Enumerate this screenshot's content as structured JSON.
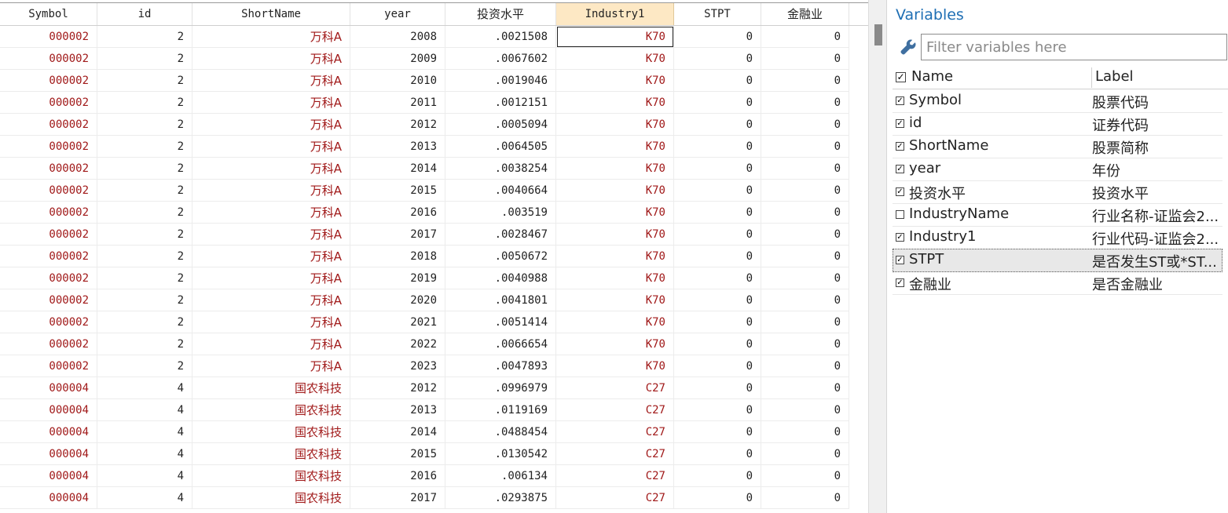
{
  "grid": {
    "columns": [
      "Symbol",
      "id",
      "ShortName",
      "year",
      "投资水平",
      "Industry1",
      "STPT",
      "金融业"
    ],
    "selected_column": "Industry1",
    "rows": [
      [
        "000002",
        "2",
        "万科A",
        "2008",
        ".0021508",
        "K70",
        "0",
        "0"
      ],
      [
        "000002",
        "2",
        "万科A",
        "2009",
        ".0067602",
        "K70",
        "0",
        "0"
      ],
      [
        "000002",
        "2",
        "万科A",
        "2010",
        ".0019046",
        "K70",
        "0",
        "0"
      ],
      [
        "000002",
        "2",
        "万科A",
        "2011",
        ".0012151",
        "K70",
        "0",
        "0"
      ],
      [
        "000002",
        "2",
        "万科A",
        "2012",
        ".0005094",
        "K70",
        "0",
        "0"
      ],
      [
        "000002",
        "2",
        "万科A",
        "2013",
        ".0064505",
        "K70",
        "0",
        "0"
      ],
      [
        "000002",
        "2",
        "万科A",
        "2014",
        ".0038254",
        "K70",
        "0",
        "0"
      ],
      [
        "000002",
        "2",
        "万科A",
        "2015",
        ".0040664",
        "K70",
        "0",
        "0"
      ],
      [
        "000002",
        "2",
        "万科A",
        "2016",
        ".003519",
        "K70",
        "0",
        "0"
      ],
      [
        "000002",
        "2",
        "万科A",
        "2017",
        ".0028467",
        "K70",
        "0",
        "0"
      ],
      [
        "000002",
        "2",
        "万科A",
        "2018",
        ".0050672",
        "K70",
        "0",
        "0"
      ],
      [
        "000002",
        "2",
        "万科A",
        "2019",
        ".0040988",
        "K70",
        "0",
        "0"
      ],
      [
        "000002",
        "2",
        "万科A",
        "2020",
        ".0041801",
        "K70",
        "0",
        "0"
      ],
      [
        "000002",
        "2",
        "万科A",
        "2021",
        ".0051414",
        "K70",
        "0",
        "0"
      ],
      [
        "000002",
        "2",
        "万科A",
        "2022",
        ".0066654",
        "K70",
        "0",
        "0"
      ],
      [
        "000002",
        "2",
        "万科A",
        "2023",
        ".0047893",
        "K70",
        "0",
        "0"
      ],
      [
        "000004",
        "4",
        "国农科技",
        "2012",
        ".0996979",
        "C27",
        "0",
        "0"
      ],
      [
        "000004",
        "4",
        "国农科技",
        "2013",
        ".0119169",
        "C27",
        "0",
        "0"
      ],
      [
        "000004",
        "4",
        "国农科技",
        "2014",
        ".0488454",
        "C27",
        "0",
        "0"
      ],
      [
        "000004",
        "4",
        "国农科技",
        "2015",
        ".0130542",
        "C27",
        "0",
        "0"
      ],
      [
        "000004",
        "4",
        "国农科技",
        "2016",
        ".006134",
        "C27",
        "0",
        "0"
      ],
      [
        "000004",
        "4",
        "国农科技",
        "2017",
        ".0293875",
        "C27",
        "0",
        "0"
      ]
    ],
    "colors": {
      "string_text": "#a01818",
      "numeric_text": "#222222",
      "selected_header_bg": "#fde8c4"
    }
  },
  "variables_panel": {
    "title": "Variables",
    "filter_placeholder": "Filter variables here",
    "filter_icon": "wrench-icon",
    "header": {
      "name": "Name",
      "label": "Label",
      "checked": true
    },
    "items": [
      {
        "name": "Symbol",
        "label": "股票代码",
        "checked": true
      },
      {
        "name": "id",
        "label": "证券代码",
        "checked": true
      },
      {
        "name": "ShortName",
        "label": "股票简称",
        "checked": true
      },
      {
        "name": "year",
        "label": "年份",
        "checked": true
      },
      {
        "name": "投资水平",
        "label": "投资水平",
        "checked": true
      },
      {
        "name": "IndustryName",
        "label": "行业名称-证监会2...",
        "checked": false
      },
      {
        "name": "Industry1",
        "label": "行业代码-证监会2...",
        "checked": true
      },
      {
        "name": "STPT",
        "label": "是否发生ST或*ST...",
        "checked": true,
        "selected": true
      },
      {
        "name": "金融业",
        "label": "是否金融业",
        "checked": true
      }
    ],
    "colors": {
      "title": "#1f6fb4"
    }
  }
}
